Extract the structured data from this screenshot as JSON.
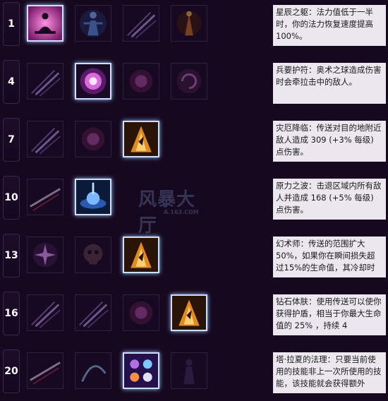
{
  "watermark": {
    "title": "风暴大厅",
    "sub": "A.163.COM"
  },
  "rows": [
    {
      "level": "1",
      "selected": 0,
      "description": "星辰之躯：法力值低于一半时，你的法力恢复速度提高100%。"
    },
    {
      "level": "4",
      "selected": 1,
      "description": "兵要护符：奥术之球造成伤害时会牵拉击中的敌人。"
    },
    {
      "level": "7",
      "selected": 2,
      "description": "灾厄降临：传送对目的地附近敌人造成 309 (+3% 每级) 点伤害。"
    },
    {
      "level": "10",
      "selected": 1,
      "description": "原力之波：击退区域内所有敌人并造成 168 (+5% 每级) 点伤害。"
    },
    {
      "level": "13",
      "selected": 2,
      "description": "幻术师：传送的范围扩大50%，如果你在瞬间损失超过15%的生命值，其冷却时"
    },
    {
      "level": "16",
      "selected": 3,
      "description": "钻石体肤：使用传送可以使你获得护盾，相当于你最大生命值的 25% ，持续 4"
    },
    {
      "level": "20",
      "selected": 2,
      "description": "塔·拉夏的法理：只要当前使用的技能非上一次所使用的技能，该技能就会获得额外"
    }
  ],
  "icons": [
    [
      "meditating-figure-icon",
      "glowing-figure-icon",
      "slash-streaks-icon",
      "fire-figure-icon"
    ],
    [
      "slash-streaks-icon",
      "arcane-orb-icon",
      "dark-orb-icon",
      "spiral-orb-icon"
    ],
    [
      "slash-streaks-icon",
      "dark-orb-icon",
      "teleport-flame-icon"
    ],
    [
      "blade-streak-icon",
      "force-wave-icon"
    ],
    [
      "star-burst-icon",
      "skull-icon",
      "teleport-flame-icon"
    ],
    [
      "slash-streaks-icon",
      "slash-streaks-icon",
      "dark-orb-icon",
      "teleport-flame-icon"
    ],
    [
      "blade-streak-icon",
      "arc-slash-icon",
      "rune-swirl-icon",
      "shadow-figure-icon"
    ]
  ]
}
